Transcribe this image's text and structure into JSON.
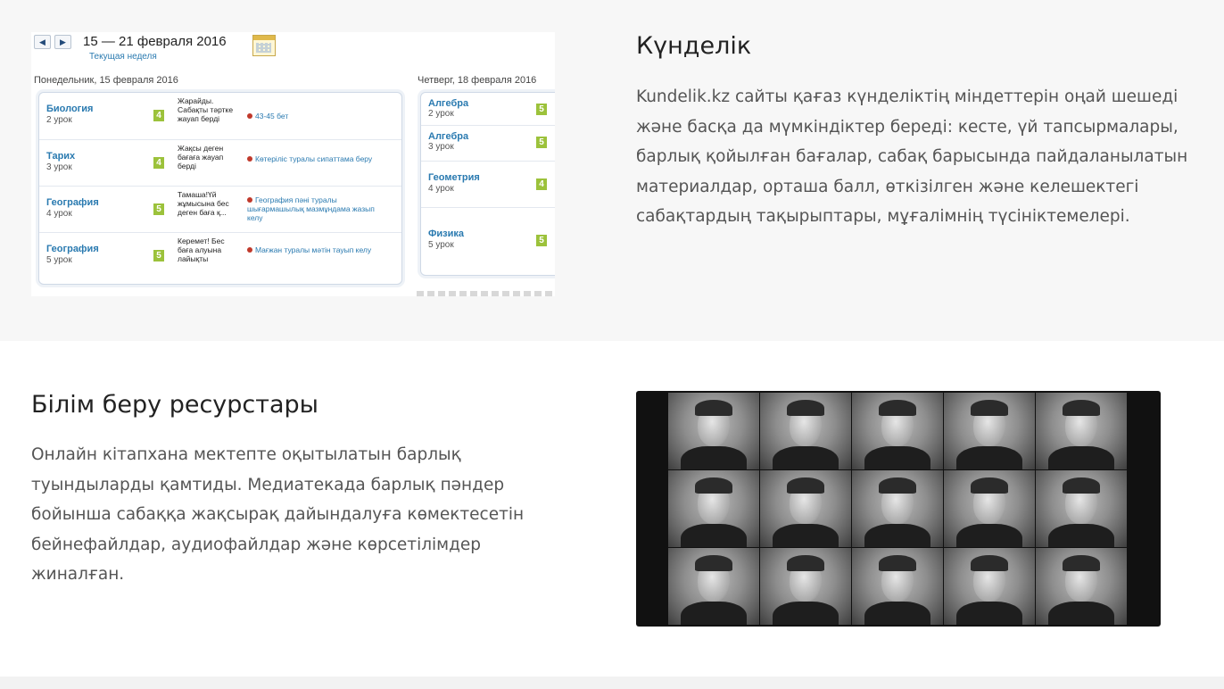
{
  "diary": {
    "nav_prev": "◀",
    "nav_next": "▶",
    "range": "15 — 21 февраля 2016",
    "current_week": "Текущая неделя",
    "monday_header": "Понедельник, 15 февраля 2016",
    "thursday_header": "Четверг, 18 февраля 2016",
    "monday_rows": [
      {
        "subject": "Биология",
        "lesson": "2 урок",
        "grade": "4",
        "comment": "Жарайды. Сабақты тəртке жауап берді",
        "homework": "43-45 бет"
      },
      {
        "subject": "Тарих",
        "lesson": "3 урок",
        "grade": "4",
        "comment": "Жақсы деген бағаға жауап берді",
        "homework": "Көтеріліс туралы сипаттама беру"
      },
      {
        "subject": "География",
        "lesson": "4 урок",
        "grade": "5",
        "comment": "Тамаша!Үй жұмысына бес деген баға қ...",
        "homework": "География пəні туралы шығармашылық мазмұндама жазып келу"
      },
      {
        "subject": "География",
        "lesson": "5 урок",
        "grade": "5",
        "comment": "Керемет! Бес баға алуына лайықты",
        "homework": "Мағжан туралы мəтін тауып келу"
      }
    ],
    "thursday_rows": [
      {
        "subject": "Алгебра",
        "lesson": "2 урок",
        "grade": "5"
      },
      {
        "subject": "Алгебра",
        "lesson": "3 урок",
        "grade": "5"
      },
      {
        "subject": "Геометрия",
        "lesson": "4 урок",
        "grade": "4"
      },
      {
        "subject": "Физика",
        "lesson": "5 урок",
        "grade": "5"
      }
    ]
  },
  "kundelik": {
    "title": "Күнделік",
    "text": "Kundelik.kz сайты қағаз күнделіктің міндеттерін оңай шешеді және басқа да мүмкіндіктер береді: кесте, үй тапсырмалары, барлық қойылған бағалар, сабақ барысында пайдаланылатын материалдар, орташа балл, өткізілген және келешектегі сабақтардың тақырыптары, мұғалімнің түсініктемелері."
  },
  "resources": {
    "title": "Білім беру ресурстары",
    "text": "Онлайн кітапхана мектепте оқытылатын барлық туындыларды қамтиды. Медиатекада барлық пəндер бойынша сабаққа жақсырақ дайындалуға көмектесетін бейнефайлдар, аудиофайлдар жəне көрсетілімдер жиналған."
  },
  "colors": {
    "heading": "#222222",
    "body_text": "#555555",
    "link_blue": "#2a7ab0",
    "grade_green": "#9cc23b",
    "band_gray": "#f7f7f7"
  }
}
